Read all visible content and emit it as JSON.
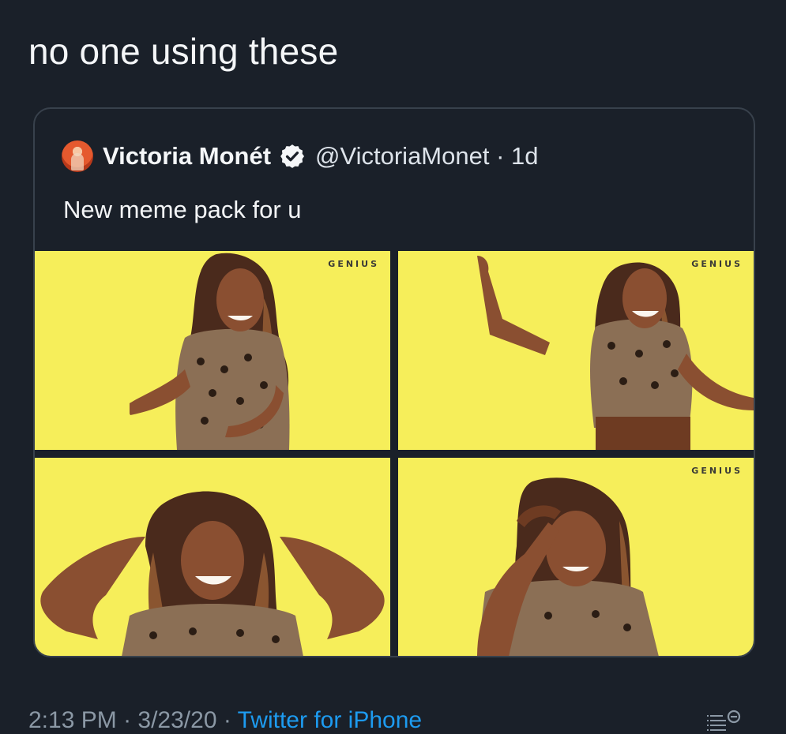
{
  "tweet": {
    "text": "no one using these"
  },
  "quoted_tweet": {
    "display_name": "Victoria Monét",
    "handle_time": "@VictoriaMonet · 1d",
    "text": "New meme pack for u",
    "avatar_icon": "profile-photo-avatar",
    "verified_icon": "verified-badge-icon",
    "media": [
      {
        "watermark": "GENIUS"
      },
      {
        "watermark": "GENIUS"
      },
      {
        "watermark": ""
      },
      {
        "watermark": "GENIUS"
      }
    ],
    "media_background": "#f6ee5a"
  },
  "footer": {
    "time": "2:13 PM",
    "date": "3/23/20",
    "source": "Twitter for iPhone",
    "analytics_icon": "analytics-icon"
  },
  "colors": {
    "background": "#1a2029",
    "text": "#f3f5f7",
    "muted": "#8b98a5",
    "accent": "#1d9bf0",
    "border": "#38414c"
  }
}
